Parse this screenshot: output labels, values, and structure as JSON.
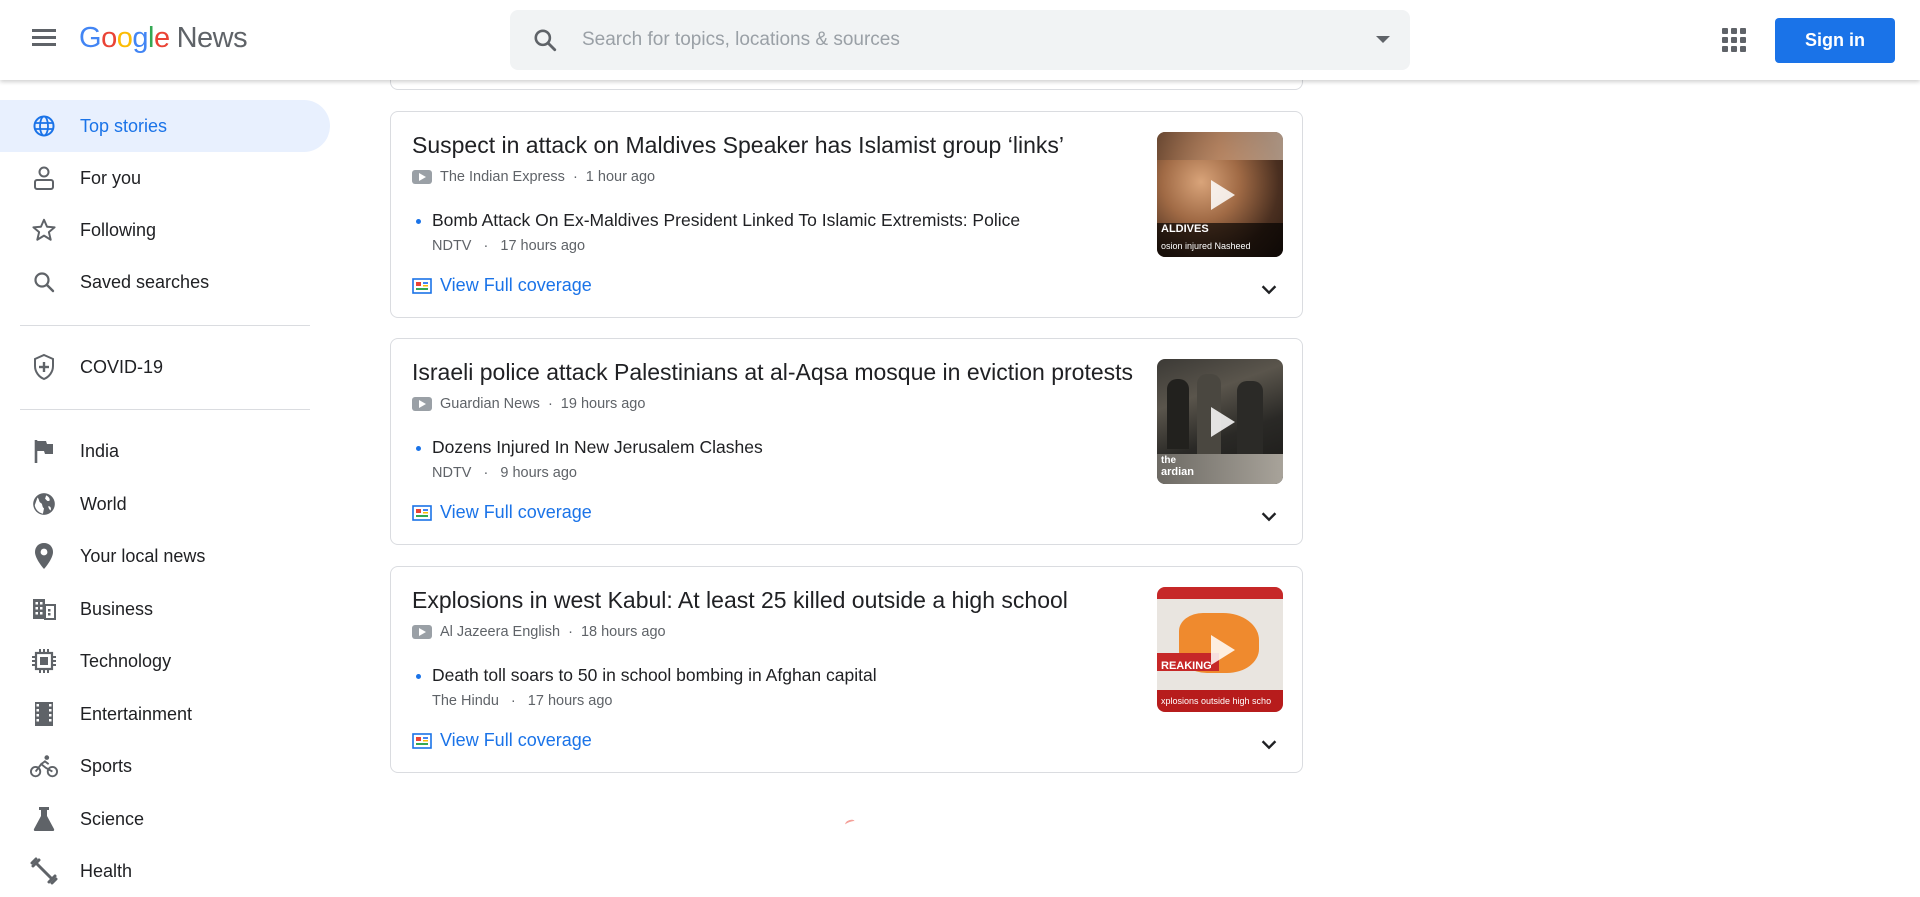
{
  "header": {
    "logo_google": [
      "G",
      "o",
      "o",
      "g",
      "l",
      "e"
    ],
    "logo_news": "News",
    "search_placeholder": "Search for topics, locations & sources",
    "signin_label": "Sign in"
  },
  "sidebar": {
    "items": [
      {
        "label": "Top stories",
        "icon": "globe-icon",
        "active": true
      },
      {
        "label": "For you",
        "icon": "person-icon"
      },
      {
        "label": "Following",
        "icon": "star-icon"
      },
      {
        "label": "Saved searches",
        "icon": "search-icon"
      },
      {
        "label": "COVID-19",
        "icon": "shield-icon"
      },
      {
        "label": "India",
        "icon": "flag-icon"
      },
      {
        "label": "World",
        "icon": "world-icon"
      },
      {
        "label": "Your local news",
        "icon": "location-pin-icon"
      },
      {
        "label": "Business",
        "icon": "building-icon"
      },
      {
        "label": "Technology",
        "icon": "chip-icon"
      },
      {
        "label": "Entertainment",
        "icon": "film-icon"
      },
      {
        "label": "Sports",
        "icon": "bike-icon"
      },
      {
        "label": "Science",
        "icon": "flask-icon"
      },
      {
        "label": "Health",
        "icon": "dumbbell-icon"
      }
    ]
  },
  "stories": [
    {
      "headline": "Suspect in attack on Maldives Speaker has Islamist group ‘links’",
      "source": "The Indian Express",
      "time": "1 hour ago",
      "sub_title": "Bomb Attack On Ex-Maldives President Linked To Islamic Extremists: Police",
      "sub_source": "NDTV",
      "sub_time": "17 hours ago",
      "full_coverage": "View Full coverage",
      "thumb_caption": "ALDIVES",
      "thumb_caption2": "osion injured Nasheed"
    },
    {
      "headline": "Israeli police attack Palestinians at al-Aqsa mosque in eviction protests",
      "source": "Guardian News",
      "time": "19 hours ago",
      "sub_title": "Dozens Injured In New Jerusalem Clashes",
      "sub_source": "NDTV",
      "sub_time": "9 hours ago",
      "full_coverage": "View Full coverage",
      "thumb_caption": "the",
      "thumb_caption2": "ardian"
    },
    {
      "headline": "Explosions in west Kabul: At least 25 killed outside a high school",
      "source": "Al Jazeera English",
      "time": "18 hours ago",
      "sub_title": "Death toll soars to 50 in school bombing in Afghan capital",
      "sub_source": "The Hindu",
      "sub_time": "17 hours ago",
      "full_coverage": "View Full coverage",
      "thumb_caption": "REAKING",
      "thumb_caption2": "xplosions outside high scho"
    }
  ],
  "colors": {
    "accent": "#1a73e8",
    "active_bg": "#e8f0fe"
  }
}
